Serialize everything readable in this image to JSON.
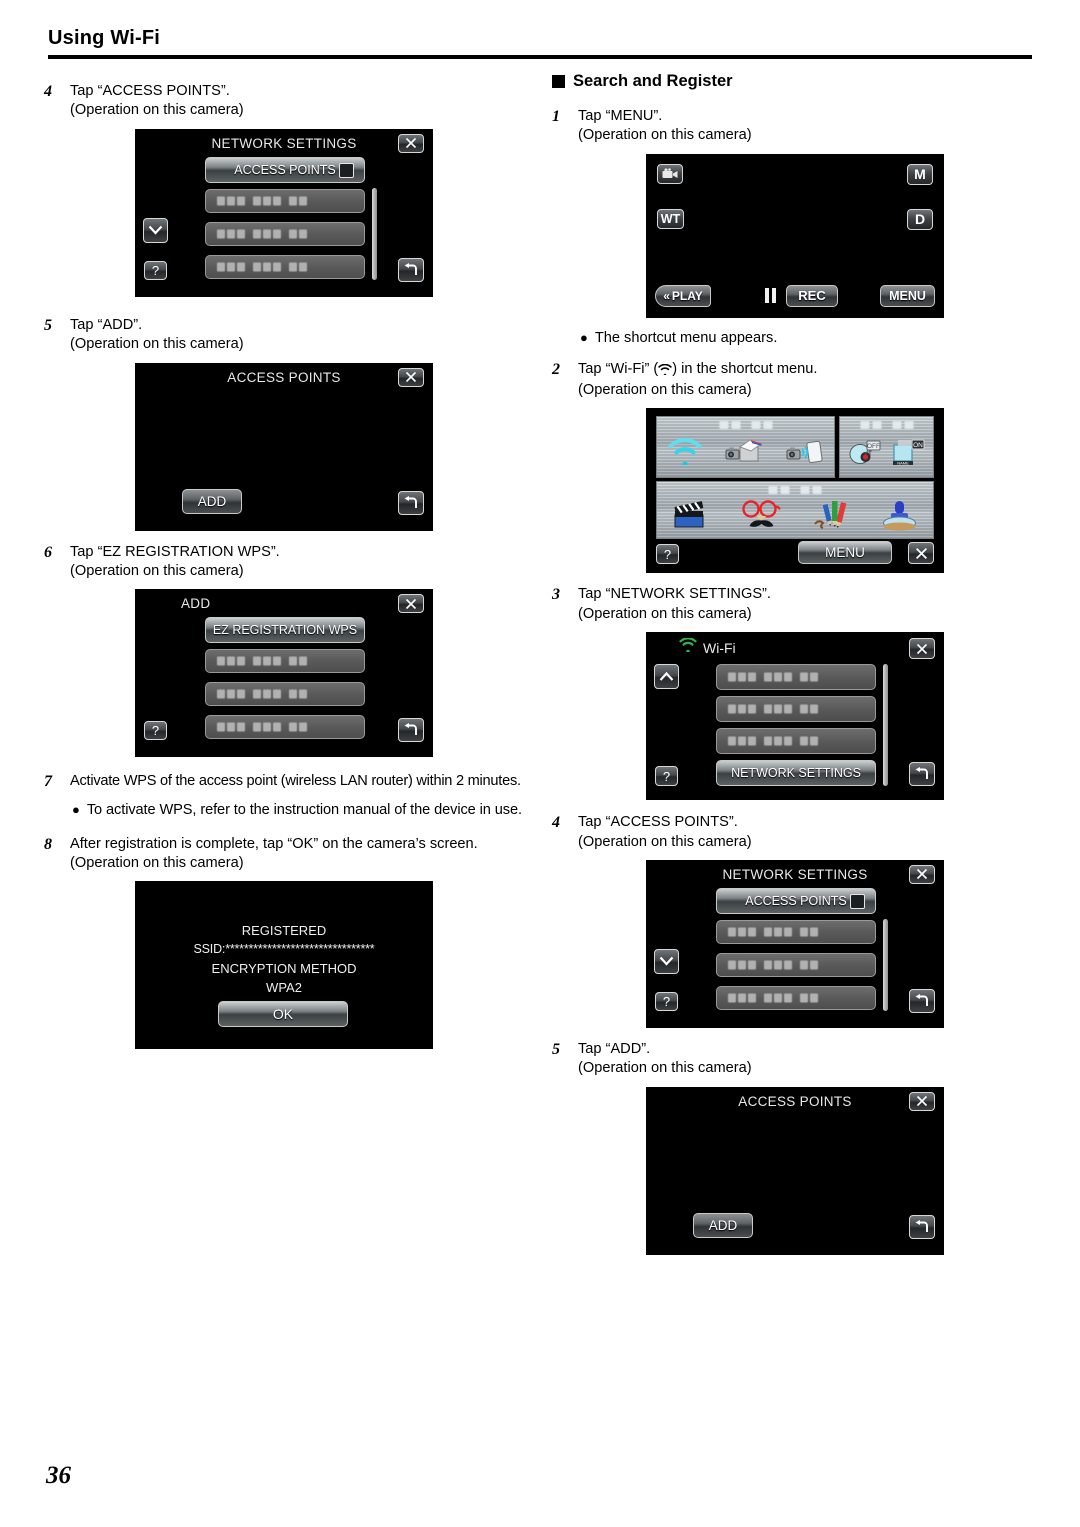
{
  "header": {
    "title": "Using Wi-Fi"
  },
  "page_number": "36",
  "left_column": {
    "steps": [
      {
        "num": "4",
        "line": "Tap “ACCESS POINTS”.",
        "sub": "(Operation on this camera)",
        "screen": "network_settings_1"
      },
      {
        "num": "5",
        "line": "Tap “ADD”.",
        "sub": "(Operation on this camera)",
        "screen": "access_points_1"
      },
      {
        "num": "6",
        "line": "Tap “EZ REGISTRATION WPS”.",
        "sub": "(Operation on this camera)",
        "screen": "add_screen"
      },
      {
        "num": "7",
        "line": "Activate WPS of the access point (wireless LAN router) within 2 minutes.",
        "bullet": "To activate WPS, refer to the instruction manual of the device in use."
      },
      {
        "num": "8",
        "line": "After registration is complete, tap “OK” on the camera’s screen.",
        "sub": "(Operation on this camera)",
        "screen": "registered"
      }
    ]
  },
  "right_column": {
    "section_heading": "Search and Register",
    "steps": [
      {
        "num": "1",
        "line": "Tap “MENU”.",
        "sub": "(Operation on this camera)",
        "screen": "rec_screen",
        "bullet_after": "The shortcut menu appears."
      },
      {
        "num": "2",
        "line_pre": "Tap “Wi-Fi” (",
        "line_post": ") in the shortcut menu.",
        "sub": "(Operation on this camera)",
        "screen": "shortcut_menu"
      },
      {
        "num": "3",
        "line": "Tap “NETWORK SETTINGS”.",
        "sub": "(Operation on this camera)",
        "screen": "wifi_list"
      },
      {
        "num": "4",
        "line": "Tap “ACCESS POINTS”.",
        "sub": "(Operation on this camera)",
        "screen": "network_settings_2"
      },
      {
        "num": "5",
        "line": "Tap “ADD”.",
        "sub": "(Operation on this camera)",
        "screen": "access_points_2"
      }
    ]
  },
  "screens": {
    "network_settings_1": {
      "title": "NETWORK SETTINGS",
      "highlight_button": "ACCESS POINTS",
      "close_icon": "close-icon",
      "back_icon": "back-icon",
      "help_icon": "?",
      "nav_icon": "chevron-down-icon",
      "list_rows": 3
    },
    "access_points_1": {
      "title": "ACCESS POINTS",
      "add_button": "ADD",
      "close_icon": "close-icon",
      "back_icon": "back-icon"
    },
    "add_screen": {
      "title": "ADD",
      "highlight_button": "EZ REGISTRATION WPS",
      "close_icon": "close-icon",
      "back_icon": "back-icon",
      "help_icon": "?",
      "list_rows": 3
    },
    "registered": {
      "line1": "REGISTERED",
      "ssid_label": "SSID:",
      "ssid_value": "********************************",
      "line3": "ENCRYPTION METHOD",
      "line4": "WPA2",
      "ok_button": "OK"
    },
    "rec_screen": {
      "mode_icon": "camcorder-icon",
      "zoom_icon": "WT",
      "m_icon": "M",
      "d_icon": "D",
      "play_button": "PLAY",
      "rec_button": "REC",
      "menu_button": "MENU",
      "pause_icon": "pause-icon"
    },
    "shortcut_menu": {
      "menu_button": "MENU",
      "close_icon": "close-icon",
      "help_icon": "?",
      "panels": [
        {
          "icons": [
            "wifi-icon",
            "camera-to-pc-icon",
            "camera-to-phone-icon"
          ]
        },
        {
          "icons": [
            "face-off-icon",
            "name-on-icon"
          ]
        },
        {
          "icons": [
            "clapperboard-icon",
            "glasses-mustache-icon",
            "pencils-icon",
            "stamp-icon"
          ]
        }
      ]
    },
    "wifi_list": {
      "title": "Wi-Fi",
      "wifi_icon": "wifi-icon",
      "highlight_button": "NETWORK SETTINGS",
      "close_icon": "close-icon",
      "back_icon": "back-icon",
      "help_icon": "?",
      "nav_icon": "chevron-up-icon",
      "list_rows": 3
    },
    "network_settings_2": {
      "title": "NETWORK SETTINGS",
      "highlight_button": "ACCESS POINTS",
      "close_icon": "close-icon",
      "back_icon": "back-icon",
      "help_icon": "?",
      "nav_icon": "chevron-down-icon",
      "list_rows": 3
    },
    "access_points_2": {
      "title": "ACCESS POINTS",
      "add_button": "ADD",
      "close_icon": "close-icon",
      "back_icon": "back-icon"
    }
  },
  "colors": {
    "accent_wifi": "#2ed0e8",
    "wifi_green": "#2fb34a",
    "screen_bg": "#000000",
    "text": "#000000"
  }
}
